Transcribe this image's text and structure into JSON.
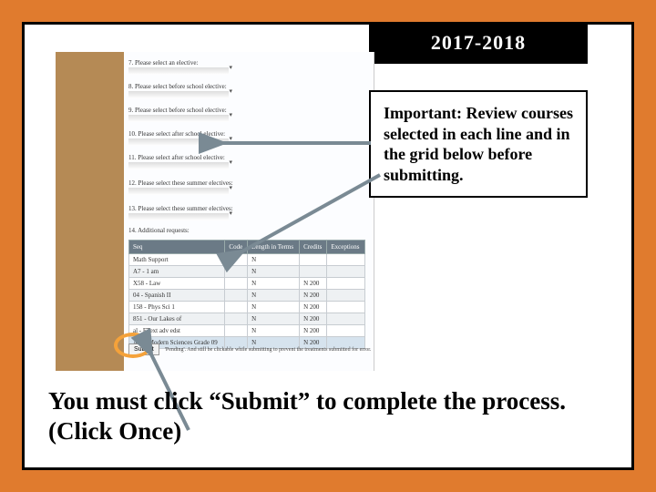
{
  "header": {
    "year": "2017-2018"
  },
  "callout": {
    "text": "Important:  Review courses selected in each line and in the grid below before submitting."
  },
  "footer": {
    "text": "You must click “Submit” to complete the process. (Click Once)"
  },
  "form": {
    "lines": [
      "7. Please select an elective:",
      "8. Please select before school elective:",
      "9. Please select before school elective:",
      "10. Please select after school elective:",
      "11. Please select after school elective:",
      "12. Please select these summer electives:",
      "13. Please select these summer electives:"
    ],
    "additional_label": "14. Additional requests:",
    "table_headers": {
      "c1": "Seq",
      "c2": "Code",
      "c3": "Length in Terms",
      "c4": "Credits",
      "c5": "Exceptions"
    },
    "rows": [
      {
        "c1": "Math Support",
        "c2": "",
        "c3": "N",
        "c4": "",
        "c5": ""
      },
      {
        "c1": "A7 - 1 am",
        "c2": "",
        "c3": "N",
        "c4": "",
        "c5": ""
      },
      {
        "c1": "X58 - Law",
        "c2": "",
        "c3": "N",
        "c4": "N 200",
        "c5": ""
      },
      {
        "c1": "04 - Spanish II",
        "c2": "",
        "c3": "N",
        "c4": "N 200",
        "c5": ""
      },
      {
        "c1": "158 - Phys Sci 1",
        "c2": "",
        "c3": "N",
        "c4": "N 200",
        "c5": ""
      },
      {
        "c1": "851 - Our Lakes of",
        "c2": "",
        "c3": "N",
        "c4": "N 200",
        "c5": ""
      },
      {
        "c1": "al - FText adv edst",
        "c2": "",
        "c3": "N",
        "c4": "N 200",
        "c5": ""
      },
      {
        "c1": "ANL-Modern Sciences Grade 09",
        "c2": "",
        "c3": "N",
        "c4": "N 200",
        "c5": ""
      }
    ],
    "submit_label": "Submit",
    "pending_note": "'Pending'. And still be clickable while submitting to prevent the treatments submitted for error."
  }
}
